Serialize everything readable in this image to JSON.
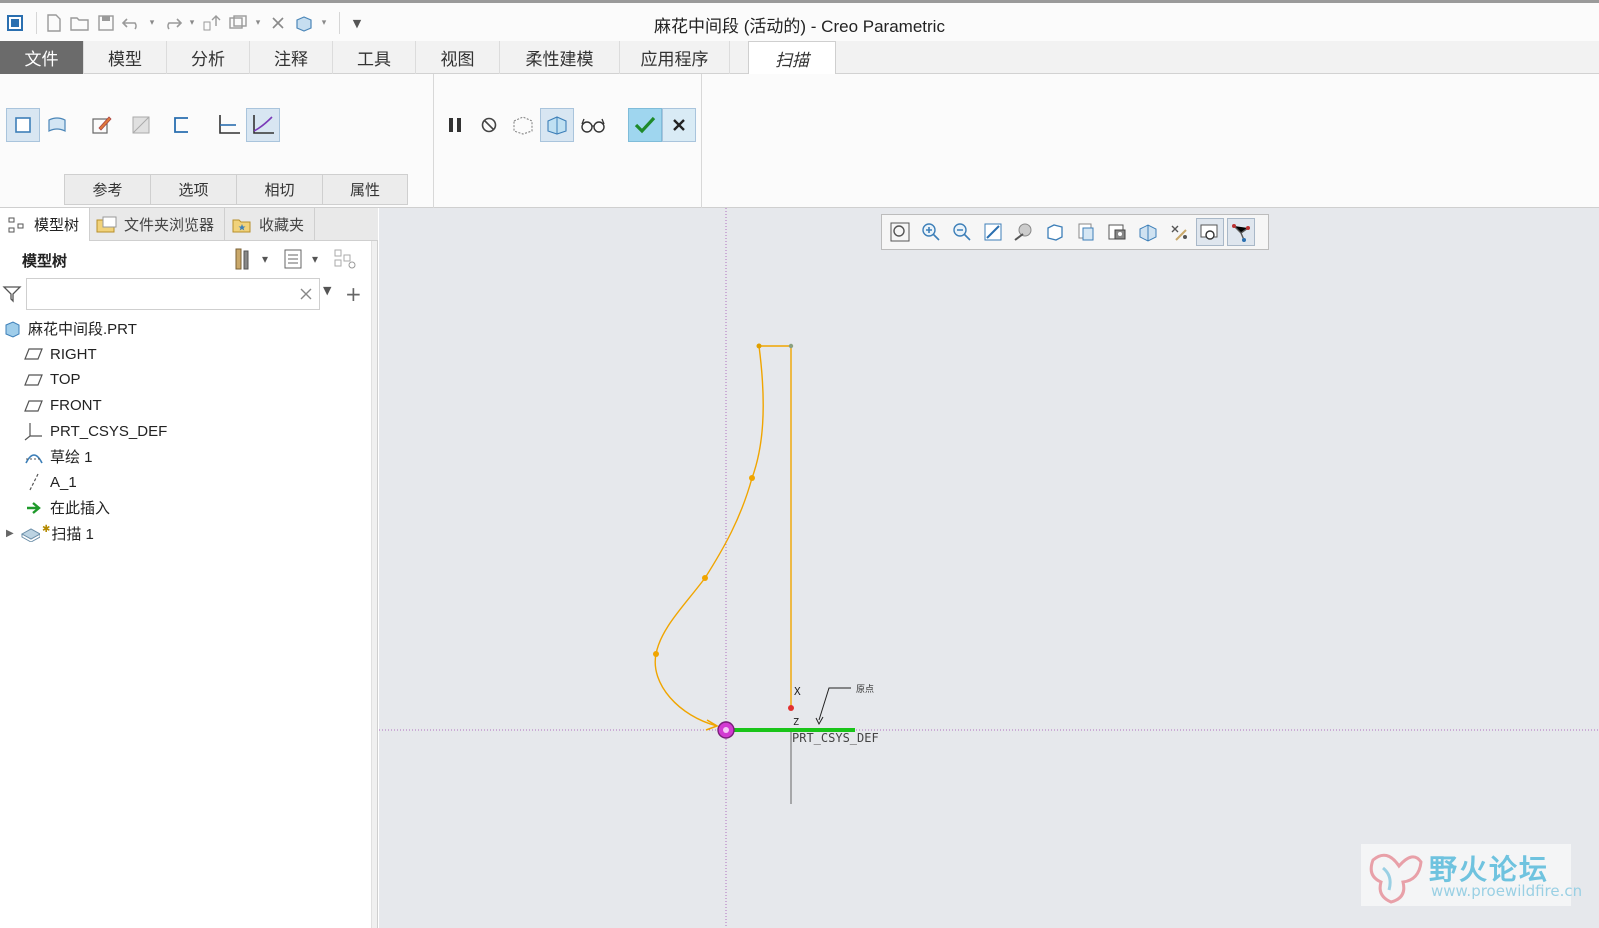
{
  "window": {
    "title": "麻花中间段 (活动的) - Creo Parametric"
  },
  "ribbon_tabs": [
    {
      "label": "文件",
      "kind": "file"
    },
    {
      "label": "模型"
    },
    {
      "label": "分析"
    },
    {
      "label": "注释"
    },
    {
      "label": "工具"
    },
    {
      "label": "视图"
    },
    {
      "label": "柔性建模"
    },
    {
      "label": "应用程序"
    },
    {
      "label": "扫描",
      "kind": "active"
    }
  ],
  "sweep_subtabs": [
    "参考",
    "选项",
    "相切",
    "属性"
  ],
  "nav_tabs": [
    "模型树",
    "文件夹浏览器",
    "收藏夹"
  ],
  "model_tree": {
    "header": "模型树",
    "search_value": "",
    "items": [
      {
        "label": "麻花中间段.PRT",
        "icon": "part-icon",
        "indent": 0
      },
      {
        "label": "RIGHT",
        "icon": "datum-plane-icon",
        "indent": 1
      },
      {
        "label": "TOP",
        "icon": "datum-plane-icon",
        "indent": 1
      },
      {
        "label": "FRONT",
        "icon": "datum-plane-icon",
        "indent": 1
      },
      {
        "label": "PRT_CSYS_DEF",
        "icon": "csys-icon",
        "indent": 1
      },
      {
        "label": "草绘 1",
        "icon": "sketch-icon",
        "indent": 1
      },
      {
        "label": "A_1",
        "icon": "axis-icon",
        "indent": 1
      },
      {
        "label": "在此插入",
        "icon": "insert-arrow-icon",
        "indent": 1
      },
      {
        "label": "扫描 1",
        "icon": "sweep-icon",
        "indent": 1,
        "expandable": true
      }
    ]
  },
  "canvas": {
    "csys_label": "PRT_CSYS_DEF",
    "axis_x_label": "X",
    "axis_z_label": "Z",
    "origin_label": "原点"
  },
  "watermark": {
    "text": "野火论坛",
    "url": "www.proewildfire.cn"
  },
  "colors": {
    "trajectory": "#f0a500",
    "sweep_highlight": "#19c419",
    "origin_marker": "#c020c0",
    "datum_lines": "#b070c0",
    "accent_ok": "#9fd6ef"
  }
}
